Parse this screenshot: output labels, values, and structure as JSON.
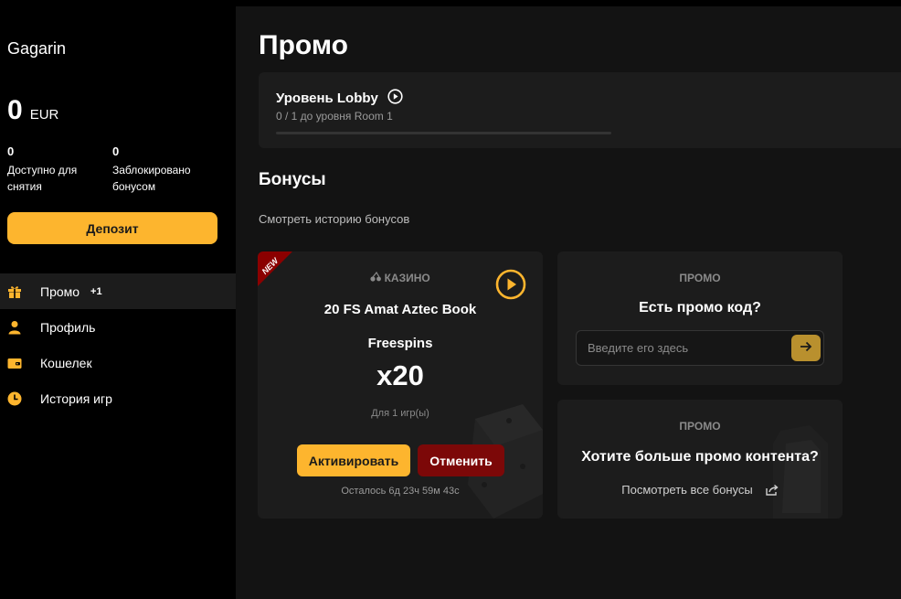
{
  "sidebar": {
    "username": "Gagarin",
    "balance": {
      "amount": "0",
      "currency": "EUR"
    },
    "available": {
      "value": "0",
      "label": "Доступно для снятия"
    },
    "locked": {
      "value": "0",
      "label": "Заблокировано бонусом"
    },
    "deposit_label": "Депозит",
    "nav": [
      {
        "label": "Промо",
        "badge": "+1",
        "icon": "gift-icon",
        "active": true
      },
      {
        "label": "Профиль",
        "icon": "user-icon"
      },
      {
        "label": "Кошелек",
        "icon": "wallet-icon"
      },
      {
        "label": "История игр",
        "icon": "clock-icon"
      }
    ]
  },
  "main": {
    "title": "Промо",
    "lobby": {
      "title": "Уровень Lobby",
      "subtitle": "0 / 1 до уровня Room 1",
      "progress": 0
    },
    "bonuses_title": "Бонусы",
    "history_link": "Смотреть историю бонусов",
    "bonus_card": {
      "ribbon": "NEW",
      "category": "КАЗИНО",
      "name": "20 FS Amat Aztec Book",
      "type": "Freespins",
      "multiplier": "x20",
      "games": "Для 1 игр(ы)",
      "activate_label": "Активировать",
      "cancel_label": "Отменить",
      "time_left": "Осталось 6д 23ч 59м 43с"
    },
    "promo_code": {
      "label": "ПРОМО",
      "heading": "Есть промо код?",
      "placeholder": "Введите его здесь"
    },
    "promo_more": {
      "label": "ПРОМО",
      "heading": "Хотите больше промо контента?",
      "link": "Посмотреть все бонусы"
    }
  },
  "colors": {
    "accent": "#fdb52e",
    "cancel": "#7c0808",
    "card": "#1c1c1c",
    "sidebar": "#000000"
  }
}
